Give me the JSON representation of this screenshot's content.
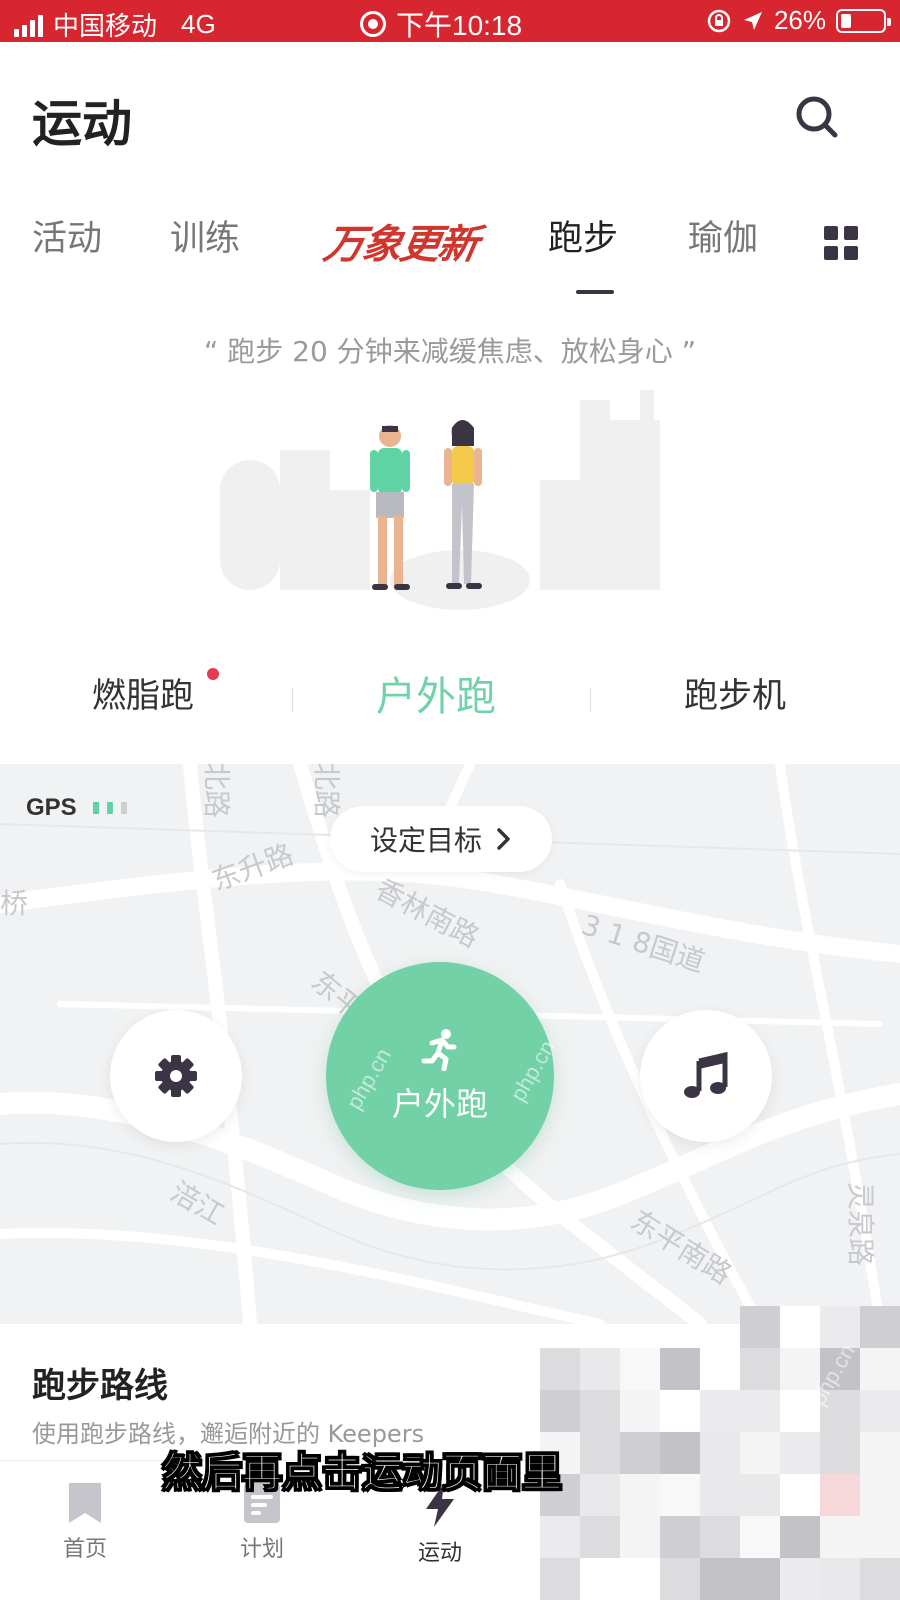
{
  "status_bar": {
    "carrier": "中国移动",
    "network": "4G",
    "time": "下午10:18",
    "battery": "26%",
    "background": "#d72630"
  },
  "header": {
    "title": "运动",
    "search_icon": "search-icon"
  },
  "tabs": {
    "items": [
      "活动",
      "训练",
      "万象更新",
      "跑步",
      "瑜伽"
    ],
    "active": "跑步",
    "more_icon": "grid-icon"
  },
  "quote": "“ 跑步 20 分钟来减缓焦虑、放松身心 ”",
  "modes": {
    "items": [
      "燃脂跑",
      "户外跑",
      "跑步机"
    ],
    "active": "户外跑",
    "accent": "#72d1a7"
  },
  "map": {
    "gps_label": "GPS",
    "gps_signal_bars": 2,
    "goal_button": "设定目标",
    "road_labels": [
      "北路",
      "北路",
      "东升路",
      "香林南路",
      "3 1 8国道",
      "东平",
      "涪江",
      "东平南路",
      "灵泉路",
      "桥"
    ],
    "start_button": "户外跑",
    "settings_icon": "gear-icon",
    "music_icon": "music-note-icon",
    "run_icon": "running-person-icon"
  },
  "routes": {
    "title": "跑步路线",
    "subtitle": "使用跑步路线，邂逅附近的 Keepers"
  },
  "bottom_nav": {
    "items": [
      {
        "label": "首页",
        "icon": "bookmark-icon"
      },
      {
        "label": "计划",
        "icon": "plan-icon"
      },
      {
        "label": "运动",
        "icon": "lightning-icon"
      }
    ],
    "active": "运动"
  },
  "overlay": {
    "caption": "然后再点击运动页面里",
    "watermark": "php.cn"
  }
}
